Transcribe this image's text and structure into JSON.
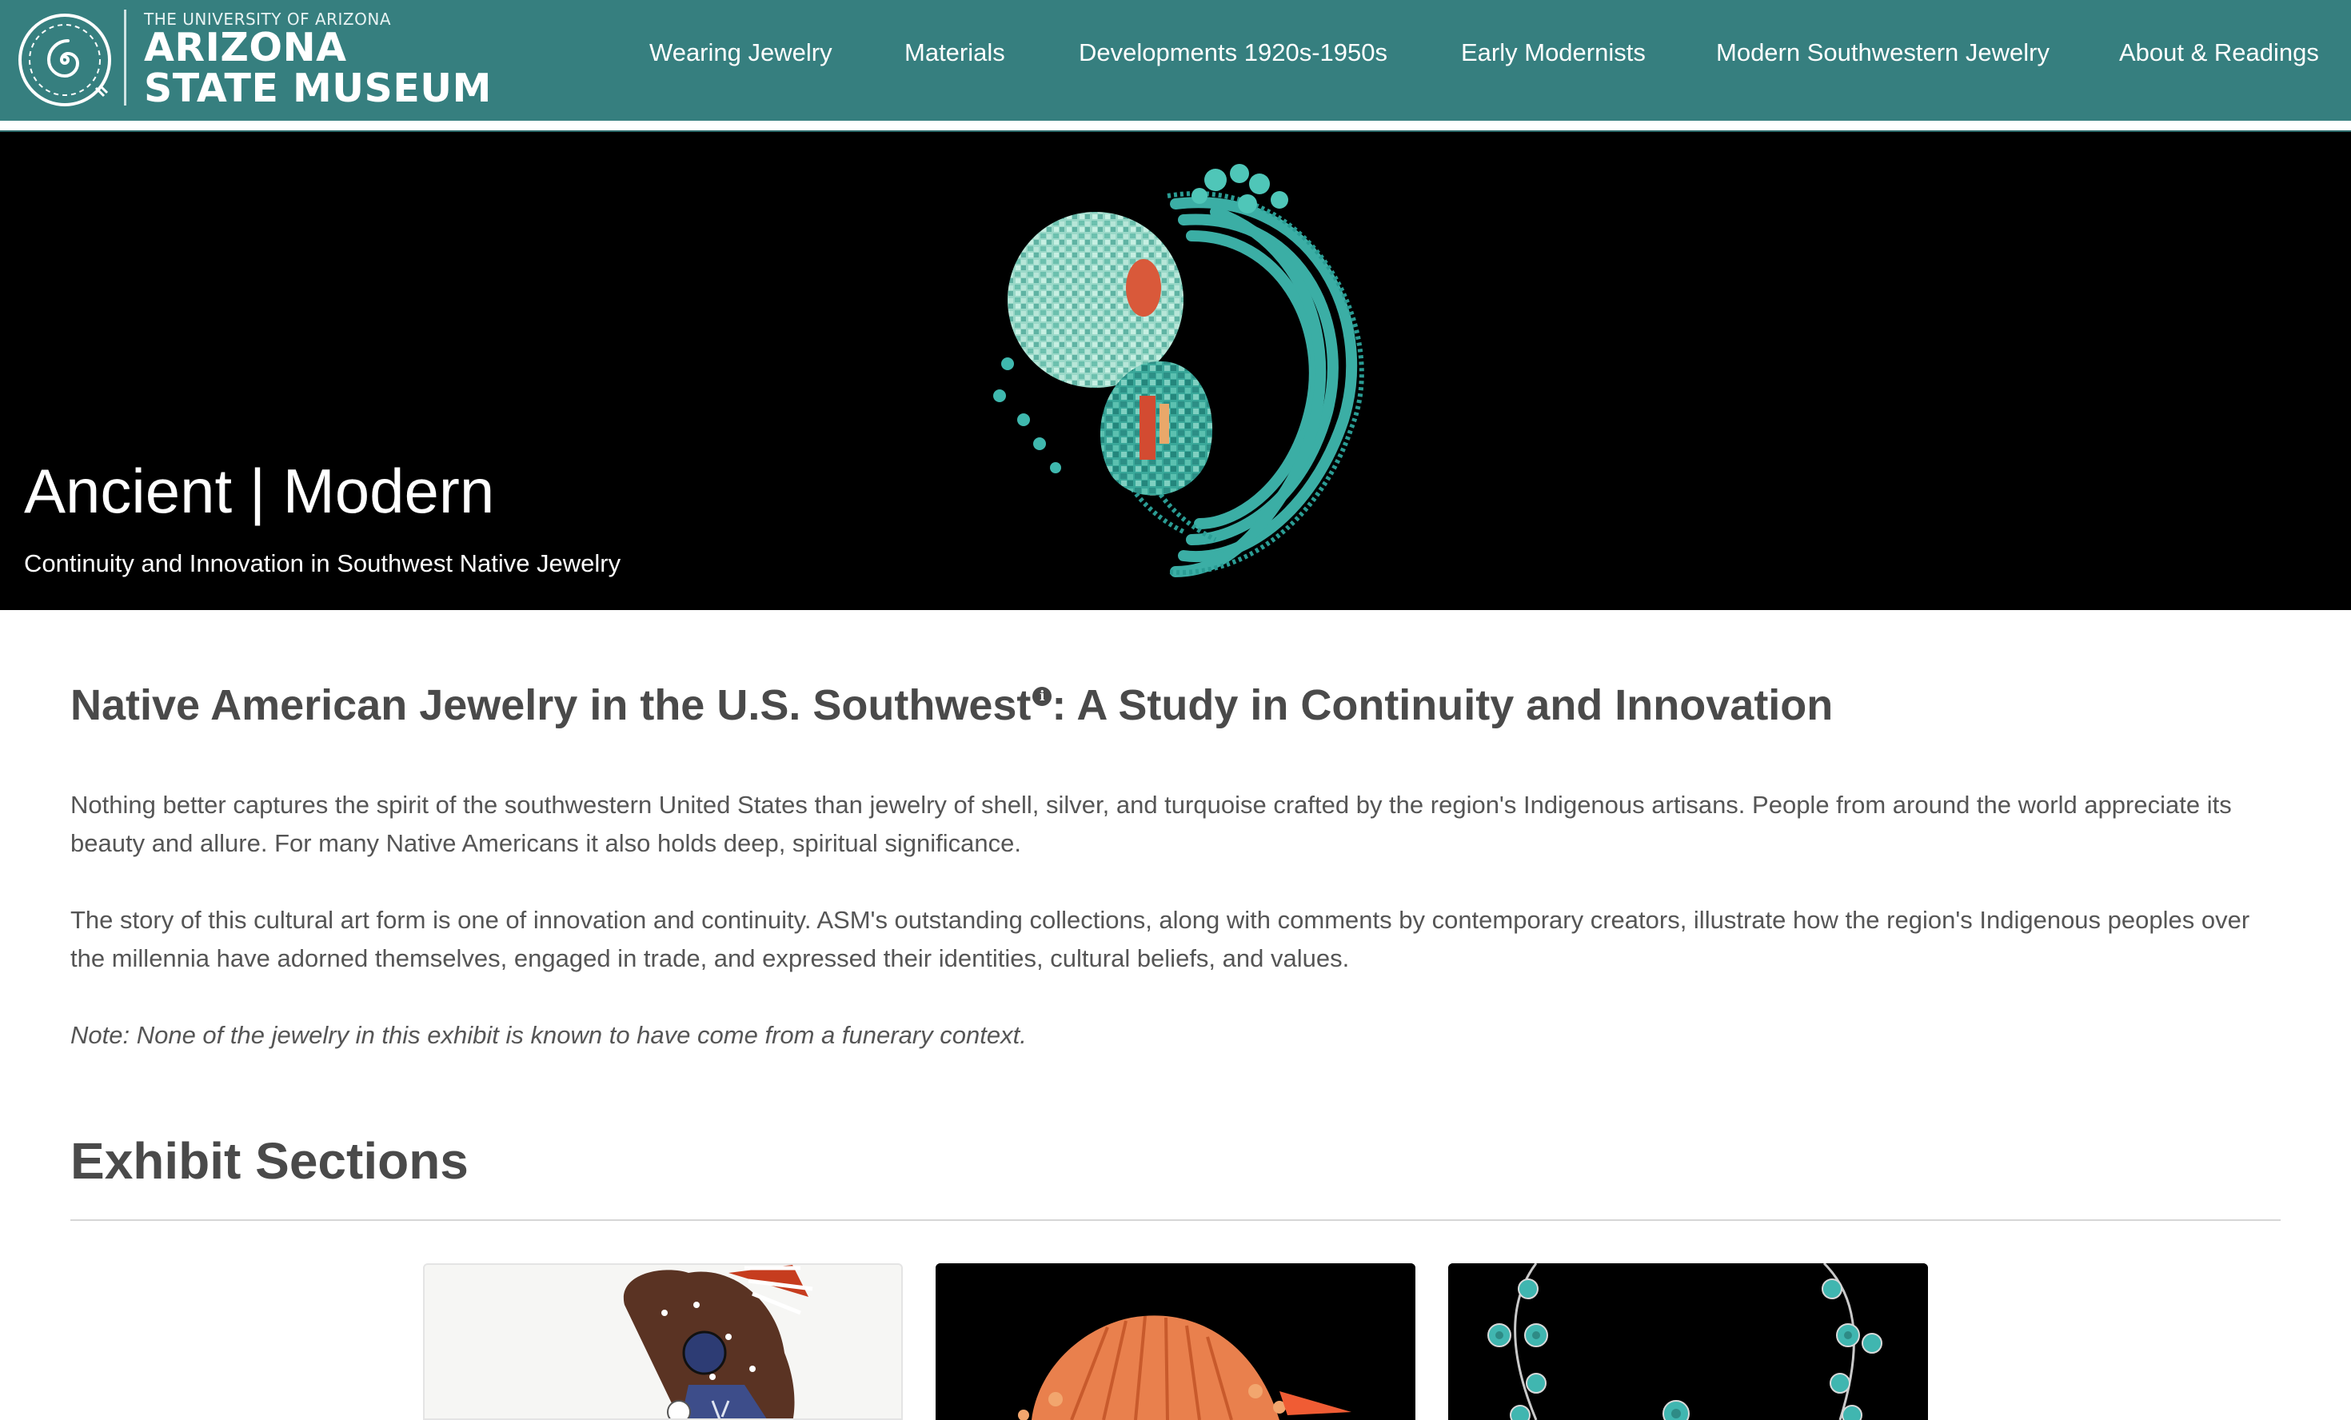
{
  "header": {
    "org_line": "THE UNIVERSITY OF ARIZONA",
    "org_name_line1": "ARIZONA",
    "org_name_line2": "STATE MUSEUM",
    "logo_icon": "spiral-sun-icon",
    "background_color": "#367f7f"
  },
  "nav": {
    "items": [
      {
        "label": "Wearing Jewelry"
      },
      {
        "label": "Materials"
      },
      {
        "label": "Developments 1920s-1950s"
      },
      {
        "label": "Early Modernists"
      },
      {
        "label": "Modern Southwestern Jewelry"
      },
      {
        "label": "About & Readings"
      }
    ]
  },
  "hero": {
    "title": "Ancient | Modern",
    "subtitle": "Continuity and Innovation in Southwest Native Jewelry",
    "image_icon": "turquoise-mosaic-jewelry-image"
  },
  "main": {
    "heading": "Native American Jewelry in the U.S. Southwest",
    "heading_info_icon": "info-icon",
    "heading_suffix": ": A Study in Continuity and Innovation",
    "paragraphs": [
      "Nothing better captures the spirit of the southwestern United States than jewelry of shell, silver, and turquoise crafted by the region's Indigenous artisans. People from around the world appreciate its beauty and allure. For many Native Americans it also holds deep, spiritual significance.",
      "The story of this cultural art form is one of innovation and continuity. ASM's outstanding collections, along with comments by contemporary creators, illustrate how the region's Indigenous peoples over the millennia have adorned themselves, engaged in trade, and expressed their identities, cultural beliefs, and values."
    ],
    "note": "Note: None of the jewelry in this exhibit is known to have come from a funerary context."
  },
  "sections": {
    "heading": "Exhibit Sections",
    "cards": [
      {
        "icon": "painted-figure-headdress-image"
      },
      {
        "icon": "spiny-oyster-shell-image"
      },
      {
        "icon": "turquoise-silver-necklace-image"
      }
    ]
  }
}
